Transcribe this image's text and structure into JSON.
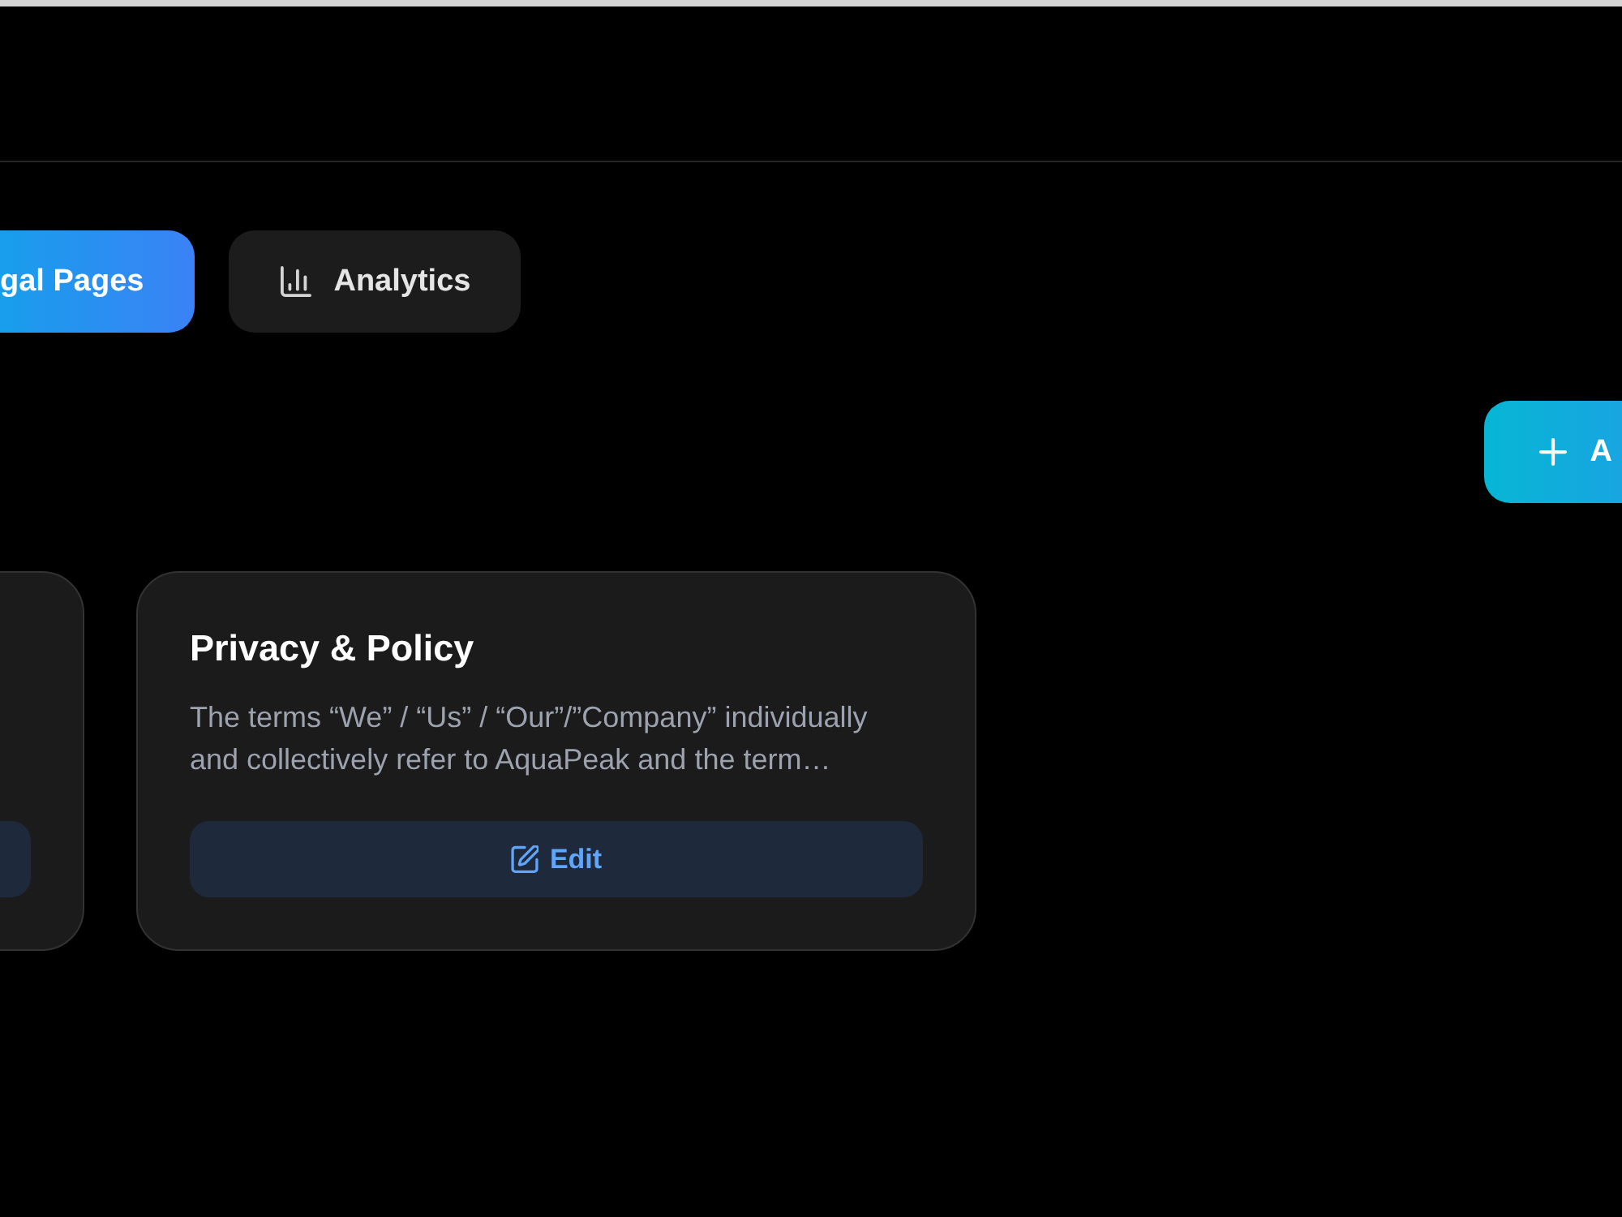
{
  "tabs": [
    {
      "label": "gal Pages",
      "selected": true
    },
    {
      "label": "Analytics",
      "selected": false,
      "icon": true
    }
  ],
  "add_button": {
    "label": "A"
  },
  "cards": [
    {
      "kind": "clipped"
    },
    {
      "kind": "full",
      "title": "Privacy & Policy",
      "description": "The terms “We” / “Us” / “Our”/”Company” individually and collectively refer to AquaPeak and the term…",
      "button_label": "Edit"
    }
  ]
}
